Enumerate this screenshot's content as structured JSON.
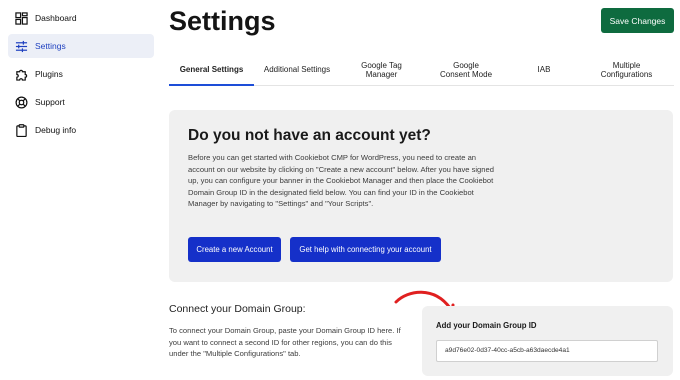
{
  "sidebar": {
    "items": [
      {
        "label": "Dashboard",
        "icon": "dashboard-icon"
      },
      {
        "label": "Settings",
        "icon": "sliders-icon"
      },
      {
        "label": "Plugins",
        "icon": "puzzle-icon"
      },
      {
        "label": "Support",
        "icon": "lifebuoy-icon"
      },
      {
        "label": "Debug info",
        "icon": "clipboard-icon"
      }
    ]
  },
  "header": {
    "title": "Settings",
    "save_label": "Save Changes"
  },
  "tabs": [
    {
      "label": "General Settings"
    },
    {
      "label": "Additional Settings"
    },
    {
      "label": "Google Tag Manager"
    },
    {
      "label": "Google Consent Mode"
    },
    {
      "label": "IAB"
    },
    {
      "label": "Multiple Configurations"
    }
  ],
  "account_card": {
    "heading": "Do you not have an account yet?",
    "body": "Before you can get started with Cookiebot CMP for WordPress, you need to create an account on our website by clicking on \"Create a new account\" below. After you have signed up, you can configure your banner in the Cookiebot Manager and then place the Cookiebot Domain Group ID in the designated field below. You can find your ID in the Cookiebot Manager by navigating to \"Settings\" and \"Your Scripts\".",
    "create_label": "Create a new Account",
    "help_label": "Get help with connecting your account"
  },
  "domain_section": {
    "heading": "Connect your Domain Group:",
    "body": "To connect your Domain Group, paste your Domain Group ID here. If you want to connect a second ID for other regions, you can do this under the \"Multiple Configurations\" tab."
  },
  "group_card": {
    "label": "Add your Domain Group ID",
    "value": "a9d76e02-0d37-40cc-a5cb-a63daecde4a1"
  },
  "colors": {
    "save_button": "#0e6b3f",
    "primary_button": "#1530c9",
    "active_tab_underline": "#1d4ed8",
    "arrow": "#e02020",
    "card_bg": "#f0f0f0",
    "active_nav_bg": "#eceff7"
  }
}
